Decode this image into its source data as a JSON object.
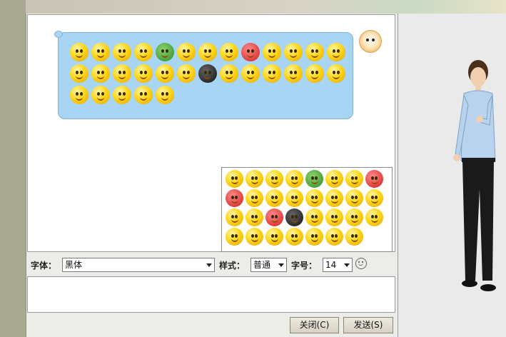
{
  "toolbar": {
    "font_label": "字体：",
    "font_value": "黑体",
    "style_label": "样式：",
    "style_value": "普通",
    "size_label": "字号：",
    "size_value": "14"
  },
  "buttons": {
    "close_label": "关闭(C)",
    "send_label": "发送(S)"
  },
  "colors": {
    "bubble": "#a9d5f4",
    "emoji_yellow": "#ffd71a",
    "panel_bg": "#ecece8"
  },
  "icons": [
    "smiley-emoji-icon",
    "dog-avatar-icon",
    "emoji-picker-icon"
  ]
}
